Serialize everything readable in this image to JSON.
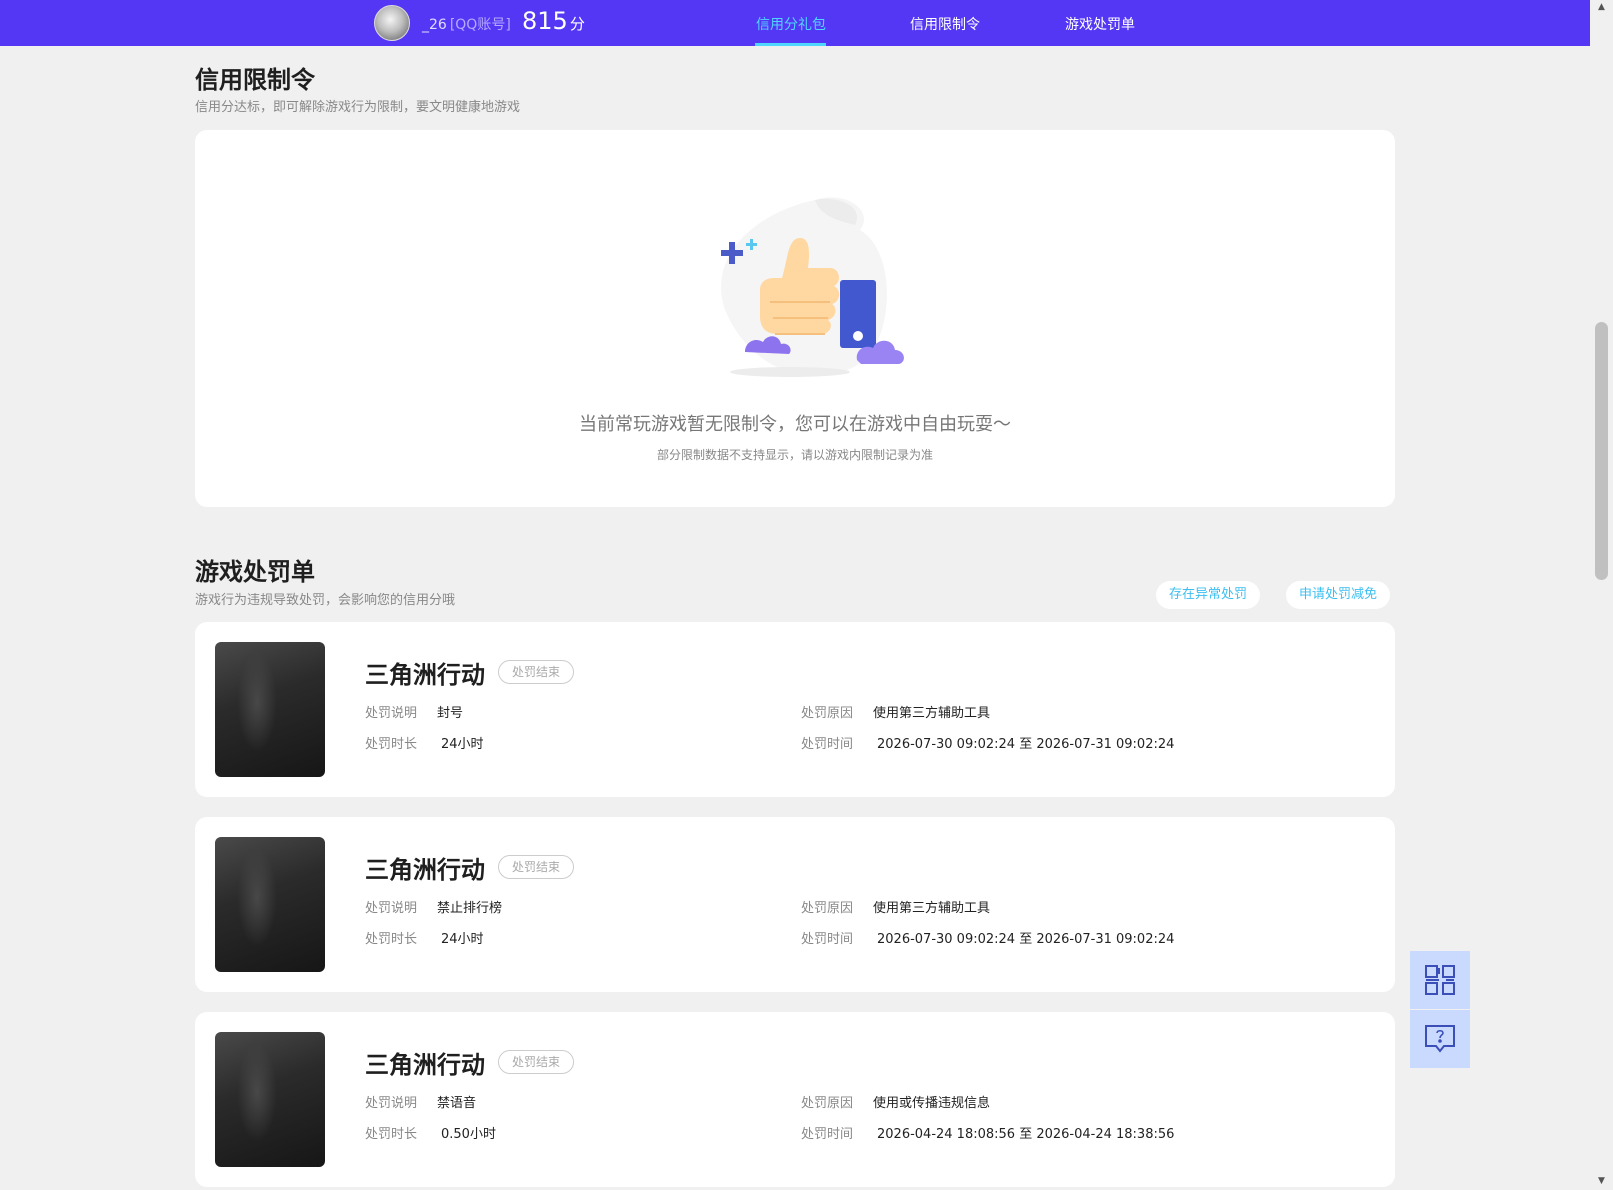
{
  "header": {
    "username": "_26",
    "account_type": "[QQ账号]",
    "score": "815",
    "score_unit": "分",
    "nav": [
      {
        "label": "信用分礼包",
        "active": true
      },
      {
        "label": "信用限制令",
        "active": false
      },
      {
        "label": "游戏处罚单",
        "active": false
      }
    ]
  },
  "restriction": {
    "title": "信用限制令",
    "subtitle": "信用分达标，即可解除游戏行为限制，要文明健康地游戏",
    "empty_message": "当前常玩游戏暂无限制令，您可以在游戏中自由玩耍～",
    "empty_note": "部分限制数据不支持显示，请以游戏内限制记录为准"
  },
  "penalty": {
    "title": "游戏处罚单",
    "subtitle": "游戏行为违规导致处罚，会影响您的信用分哦",
    "btn_abnormal": "存在异常处罚",
    "btn_reduce": "申请处罚减免",
    "labels": {
      "desc": "处罚说明",
      "duration": "处罚时长",
      "reason": "处罚原因",
      "time": "处罚时间"
    },
    "items": [
      {
        "game": "三角洲行动",
        "status": "处罚结束",
        "desc": "封号",
        "duration": "24小时",
        "reason": "使用第三方辅助工具",
        "time": "2026-07-30 09:02:24 至 2026-07-31 09:02:24"
      },
      {
        "game": "三角洲行动",
        "status": "处罚结束",
        "desc": "禁止排行榜",
        "duration": "24小时",
        "reason": "使用第三方辅助工具",
        "time": "2026-07-30 09:02:24 至 2026-07-31 09:02:24"
      },
      {
        "game": "三角洲行动",
        "status": "处罚结束",
        "desc": "禁语音",
        "duration": "0.50小时",
        "reason": "使用或传播违规信息",
        "time": "2026-04-24 18:08:56 至 2026-04-24 18:38:56"
      }
    ]
  },
  "colors": {
    "header_bg": "#5437f5",
    "accent": "#4fd6ff",
    "link": "#3cbff0",
    "side_btn": "#c9dafe"
  },
  "side": {
    "icons": [
      "qrcode-icon",
      "help-chat-icon"
    ]
  }
}
